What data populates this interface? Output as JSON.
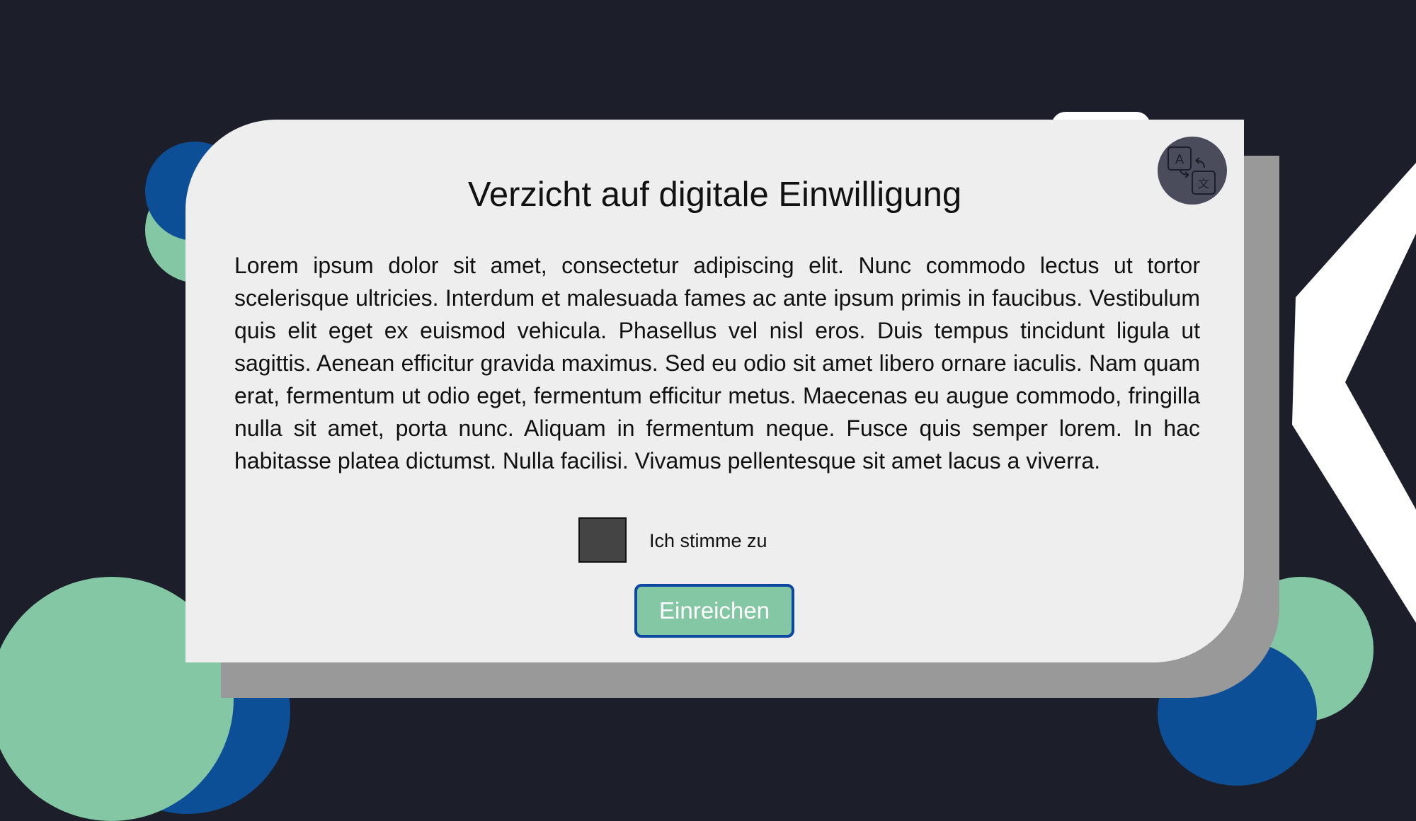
{
  "colors": {
    "background": "#1c1f29",
    "card": "#eeeeee",
    "card_shadow": "#999999",
    "accent_green": "#84c7a4",
    "accent_blue": "#0d48a0",
    "checkbox": "#444444",
    "language_button": "#4a4c5c"
  },
  "dialog": {
    "title": "Verzicht auf digitale Einwilligung",
    "body": "Lorem ipsum dolor sit amet, consectetur adipiscing elit. Nunc commodo lectus ut tortor scelerisque ultricies. Interdum et malesuada fames ac ante ipsum primis in faucibus. Vestibulum quis elit eget ex euismod vehicula. Phasellus vel nisl eros. Duis tempus tincidunt ligula ut sagittis. Aenean efficitur gravida maximus. Sed eu odio sit amet libero ornare iaculis. Nam quam erat, fermentum ut odio eget, fermentum efficitur metus. Maecenas eu augue commodo, fringilla nulla sit amet, porta nunc. Aliquam in fermentum neque. Fusce quis semper lorem. In hac habitasse platea dictumst. Nulla facilisi. Vivamus pellentesque sit amet lacus a viverra.",
    "consent_label": "Ich stimme zu",
    "consent_checked": false,
    "submit_label": "Einreichen"
  },
  "icons": {
    "language": "translate-icon"
  }
}
